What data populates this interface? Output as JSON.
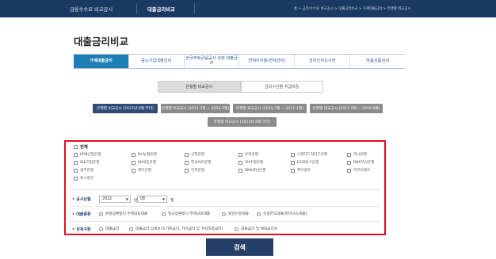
{
  "top_nav": {
    "item_1": "금융수수료 비교공시",
    "item_2": "대출금리비교",
    "breadcrumb": "홈 > 금리/수수료 비교공시 > 대출금리비교 > 가계대출금리 > 은행별 비교공시"
  },
  "page_title": "대출금리비교",
  "tabs": [
    {
      "label": "가계대출금리"
    },
    {
      "label": "중소기업대출금리"
    },
    {
      "label": "한국주택금융공사 관련 대출금리"
    },
    {
      "label": "연체이자율(연체금리)"
    },
    {
      "label": "금리인하요구권"
    },
    {
      "label": "맞춤상품검색"
    }
  ],
  "subtabs": [
    {
      "label": "은행별 비교공시"
    },
    {
      "label": "금리구간별 취급비중"
    }
  ],
  "periods": [
    {
      "label": "은행별 비교공시 (2022년 8월 부터)"
    },
    {
      "label": "은행별 비교공시 (2021.2월 ~ 2022.7월)"
    },
    {
      "label": "은행별 비교공시 (2019.7월 ~ 2021.1월)"
    },
    {
      "label": "은행별 비교공시 (2015.9월 ~ 2019.6월)"
    },
    {
      "label": "은행별 비교공시 (2015년 8월 이전)"
    }
  ],
  "filter": {
    "all_label": "전체",
    "banks": [
      "KDB산업은행",
      "NH농협은행",
      "신한은행",
      "우리은행",
      "스탠다드차타드은행",
      "하나은행",
      "IBK기업은행",
      "KB국민은행",
      "한국씨티은행",
      "SH수협은행",
      "DGB대구은행",
      "BNK부산은행",
      "광주은행",
      "제주은행",
      "전북은행",
      "BNK경남은행",
      "케이뱅크",
      "카카오뱅크",
      "토스뱅크"
    ],
    "date": {
      "label": "공시년월",
      "year": "2022",
      "year_unit": "년",
      "month": "08",
      "month_unit": "월"
    },
    "loan_type": {
      "label": "대출종류",
      "options": [
        "분할상환방식 주택담보대출",
        "일시상환방식 주택담보대출",
        "일반신용대출",
        "신용한도대출(마이너스대출)"
      ]
    },
    "detail": {
      "label": "상세구분",
      "options": [
        "대출금리",
        "대출금리 상세보기(기준금리, 가산금리 및 가감조정금리)",
        "대출금리 및 예대금리차"
      ]
    }
  },
  "search_button": "검색",
  "colors": {
    "nav_bg": "#1b3a63",
    "tab_active": "#1c7fb5",
    "period_active": "#2e4a75",
    "highlight_border": "#e2101f",
    "search_button": "#253f67"
  }
}
